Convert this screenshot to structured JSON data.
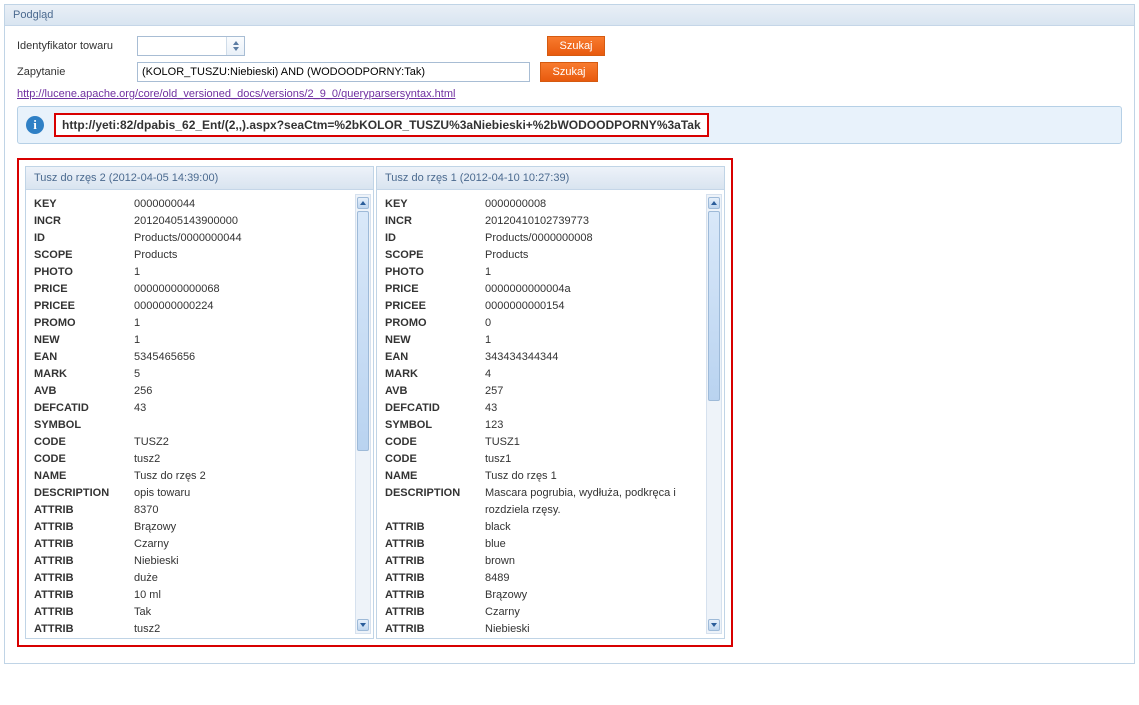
{
  "panel": {
    "title": "Podgląd"
  },
  "form": {
    "id_label": "Identyfikator towaru",
    "id_value": "",
    "query_label": "Zapytanie",
    "query_value": "(KOLOR_TUSZU:Niebieski) AND (WODOODPORNY:Tak)",
    "search_label": "Szukaj",
    "help_link": "http://lucene.apache.org/core/old_versioned_docs/versions/2_9_0/queryparsersyntax.html"
  },
  "info_url": "http://yeti:82/dpabis_62_Ent/(2,,).aspx?seaCtm=%2bKOLOR_TUSZU%3aNiebieski+%2bWODOODPORNY%3aTak",
  "results": [
    {
      "title": "Tusz do rzęs 2 (2012-04-05 14:39:00)",
      "rows": [
        {
          "k": "KEY",
          "v": "0000000044"
        },
        {
          "k": "INCR",
          "v": "20120405143900000"
        },
        {
          "k": "ID",
          "v": "Products/0000000044"
        },
        {
          "k": "SCOPE",
          "v": "Products"
        },
        {
          "k": "PHOTO",
          "v": "1"
        },
        {
          "k": "PRICE",
          "v": "00000000000068"
        },
        {
          "k": "PRICEE",
          "v": "0000000000224"
        },
        {
          "k": "PROMO",
          "v": "1"
        },
        {
          "k": "NEW",
          "v": "1"
        },
        {
          "k": "EAN",
          "v": "5345465656"
        },
        {
          "k": "MARK",
          "v": "5"
        },
        {
          "k": "AVB",
          "v": "256"
        },
        {
          "k": "DEFCATID",
          "v": "43"
        },
        {
          "k": "SYMBOL",
          "v": ""
        },
        {
          "k": "CODE",
          "v": "TUSZ2"
        },
        {
          "k": "CODE",
          "v": "tusz2"
        },
        {
          "k": "NAME",
          "v": "Tusz do rzęs 2"
        },
        {
          "k": "DESCRIPTION",
          "v": "opis towaru"
        },
        {
          "k": "ATTRIB",
          "v": "8370"
        },
        {
          "k": "ATTRIB",
          "v": "Brązowy"
        },
        {
          "k": "ATTRIB",
          "v": "Czarny"
        },
        {
          "k": "ATTRIB",
          "v": "Niebieski"
        },
        {
          "k": "ATTRIB",
          "v": "duże"
        },
        {
          "k": "ATTRIB",
          "v": "10 ml"
        },
        {
          "k": "ATTRIB",
          "v": "Tak"
        },
        {
          "k": "ATTRIB",
          "v": "tusz2"
        }
      ]
    },
    {
      "title": "Tusz do rzęs 1 (2012-04-10 10:27:39)",
      "rows": [
        {
          "k": "KEY",
          "v": "0000000008"
        },
        {
          "k": "INCR",
          "v": "20120410102739773"
        },
        {
          "k": "ID",
          "v": "Products/0000000008"
        },
        {
          "k": "SCOPE",
          "v": "Products"
        },
        {
          "k": "PHOTO",
          "v": "1"
        },
        {
          "k": "PRICE",
          "v": "0000000000004a"
        },
        {
          "k": "PRICEE",
          "v": "0000000000154"
        },
        {
          "k": "PROMO",
          "v": "0"
        },
        {
          "k": "NEW",
          "v": "1"
        },
        {
          "k": "EAN",
          "v": "343434344344"
        },
        {
          "k": "MARK",
          "v": "4"
        },
        {
          "k": "AVB",
          "v": "257"
        },
        {
          "k": "DEFCATID",
          "v": "43"
        },
        {
          "k": "SYMBOL",
          "v": "123"
        },
        {
          "k": "CODE",
          "v": "TUSZ1"
        },
        {
          "k": "CODE",
          "v": "tusz1"
        },
        {
          "k": "NAME",
          "v": "Tusz do rzęs 1"
        },
        {
          "k": "DESCRIPTION",
          "v": "Mascara pogrubia, wydłuża, podkręca i rozdziela rzęsy."
        },
        {
          "k": "ATTRIB",
          "v": "black"
        },
        {
          "k": "ATTRIB",
          "v": "blue"
        },
        {
          "k": "ATTRIB",
          "v": "brown"
        },
        {
          "k": "ATTRIB",
          "v": "8489"
        },
        {
          "k": "ATTRIB",
          "v": "Brązowy"
        },
        {
          "k": "ATTRIB",
          "v": "Czarny"
        },
        {
          "k": "ATTRIB",
          "v": "Niebieski"
        }
      ]
    }
  ]
}
